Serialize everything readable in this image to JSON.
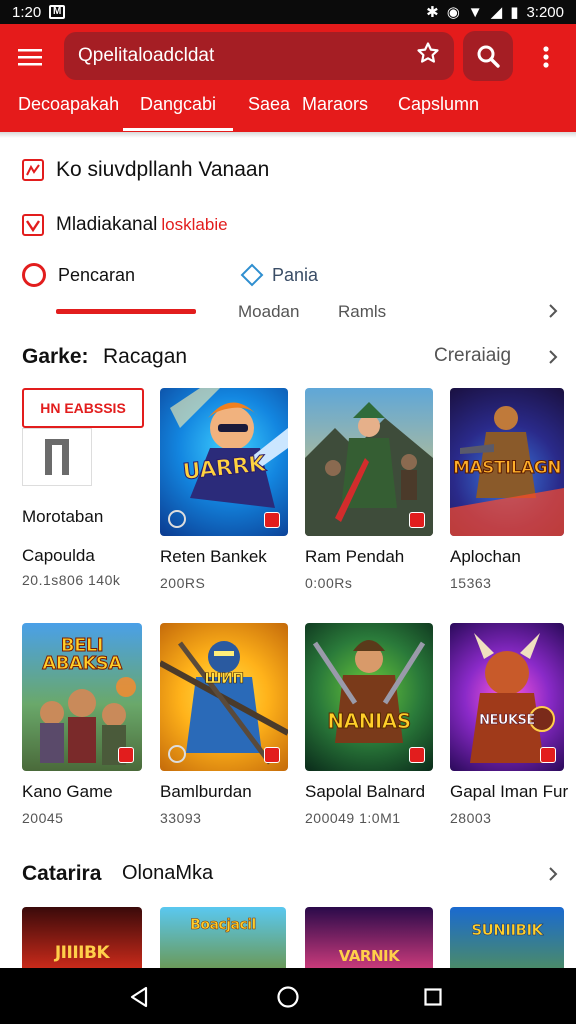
{
  "status_bar": {
    "time": "1:20",
    "mail_icon": "M",
    "clock_right": "3:200"
  },
  "appbar": {
    "menu_icon": "hamburger-icon",
    "search_query": "Qpelitaloadcldat",
    "star_icon": "star-icon",
    "search_icon": "search-icon",
    "more_icon": "more-vert-icon",
    "color": "#e51b1b",
    "search_bg": "#a51e24"
  },
  "tabs": [
    "Decoapakah",
    "Dangcabi",
    "Saea",
    "Maraors",
    "Capslumn"
  ],
  "active_tab": "Dangcabi",
  "filters": {
    "row1": "Ko siuvdpllanh Vanaan",
    "row2_main": "Mladiakanal",
    "row2_accent": "losklabie",
    "row3_left": "Pencaran",
    "row3_right": "Pania",
    "row4_a": "Moadan",
    "row4_b": "Ramls"
  },
  "section1": {
    "title_a": "Garke:",
    "title_b": "Racagan",
    "action": "Creraiaig"
  },
  "featured": {
    "badge": "HN EABSSIS",
    "label": "Morotaban"
  },
  "row1_cards": [
    {
      "thumb_text": "UARRK",
      "title": "Reten Bankek",
      "sub": "200RS"
    },
    {
      "thumb_text": "",
      "title": "Ram Pendah",
      "sub": "0:00Rs"
    },
    {
      "thumb_text": "MASTILAGN",
      "title": "Aplochan",
      "sub": "15363"
    }
  ],
  "row0_card": {
    "title": "Capoulda",
    "sub": "20.1s806 140k"
  },
  "row2_cards": [
    {
      "thumb_text": "BELI ABAKSA",
      "title": "Kano Game",
      "sub": "20045"
    },
    {
      "thumb_text": "ШИП",
      "title": "Bamlburdan",
      "sub": "33093"
    },
    {
      "thumb_text": "NANIAS",
      "title": "Sapolal Balnard",
      "sub": "200049 1:0M1"
    },
    {
      "thumb_text": "NEUKSE",
      "title": "Gapal Iman Fur",
      "sub": "28003"
    }
  ],
  "section2": {
    "title_a": "Catarira",
    "title_b": "OlonaMka"
  },
  "row3_cards": [
    {
      "thumb_text": "JIIIIBK"
    },
    {
      "thumb_text": "Boacjacil"
    },
    {
      "thumb_text": "VARNIK"
    },
    {
      "thumb_text": "SUNIIBIK"
    }
  ],
  "nav": {
    "back_icon": "back-icon",
    "home_icon": "home-icon",
    "recents_icon": "recents-icon"
  }
}
